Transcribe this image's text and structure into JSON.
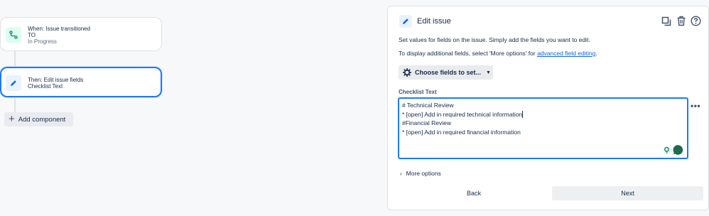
{
  "flow": {
    "trigger": {
      "line1": "When: Issue transitioned",
      "line2": "TO",
      "line3": "In Progress"
    },
    "action": {
      "line1": "Then: Edit issue fields",
      "line2": "Checklist Text"
    },
    "add_component_label": "Add component"
  },
  "panel": {
    "title": "Edit issue",
    "description": "Set values for fields on the issue. Simply add the fields you want to edit.",
    "more_info_prefix": "To display additional fields, select 'More options' for ",
    "more_info_link": "advanced field editing",
    "more_info_suffix": ".",
    "choose_fields_label": "Choose fields to set...",
    "field": {
      "label": "Checklist Text",
      "lines": [
        "# Technical Review",
        "* [open] Add in required technical information",
        "#Financial Review",
        "* [open] Add in required financial information"
      ]
    },
    "more_options_label": "More options",
    "back_label": "Back",
    "next_label": "Next"
  },
  "colors": {
    "accent": "#1d7afc",
    "trigger_icon_bg": "#dcfff1",
    "trigger_icon": "#1f845a"
  }
}
